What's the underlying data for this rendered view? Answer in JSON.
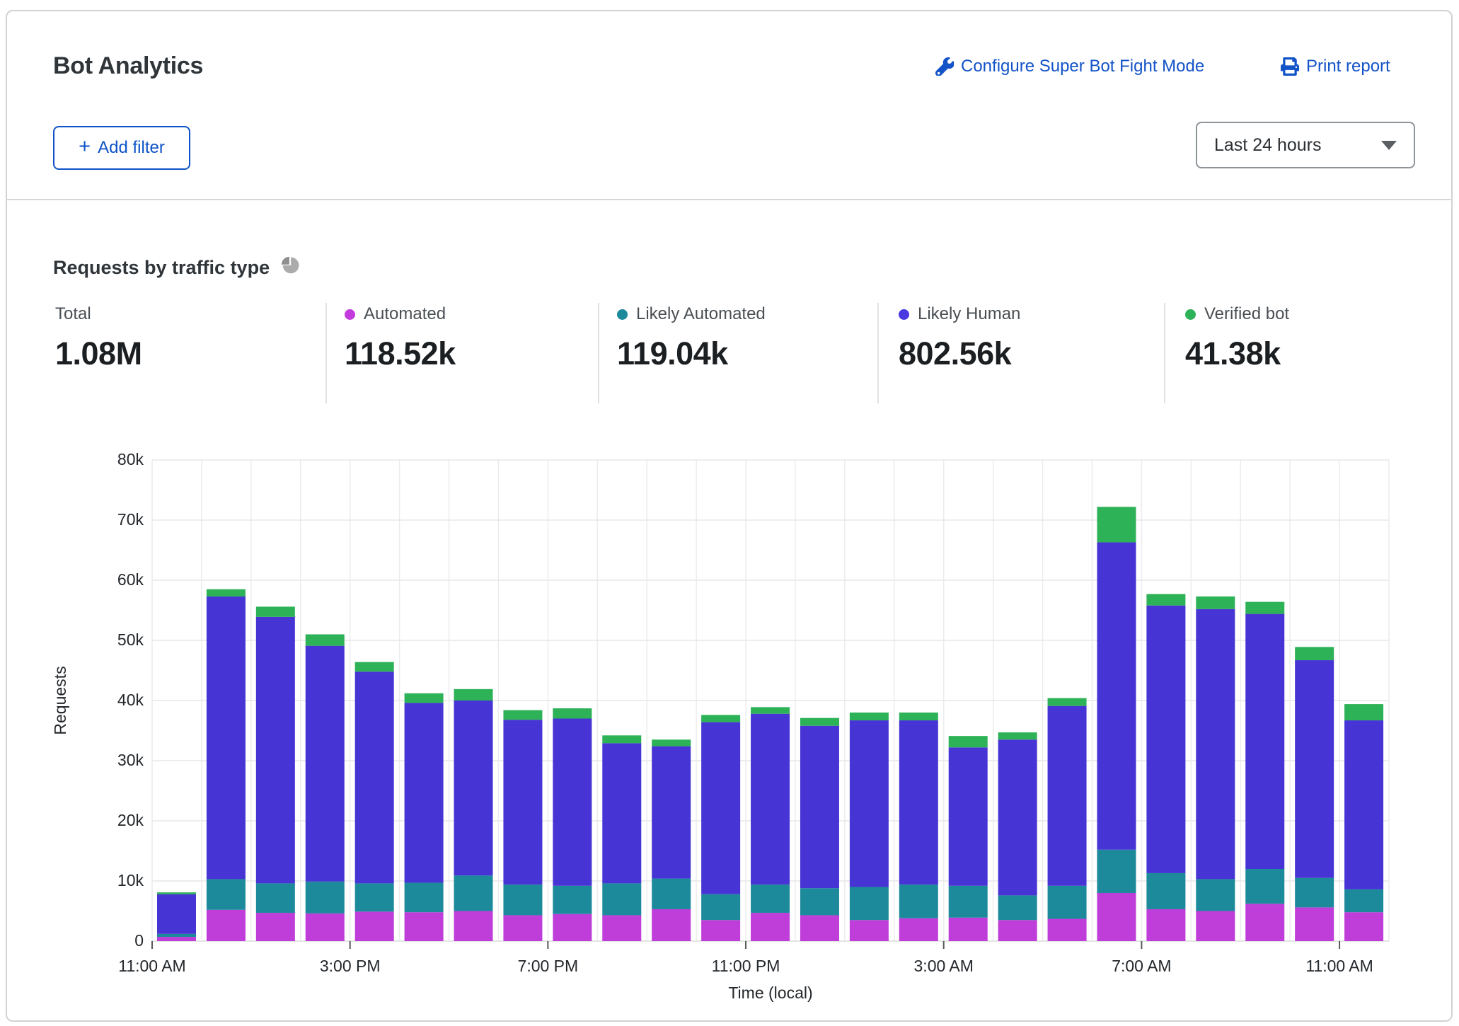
{
  "header": {
    "title": "Bot Analytics",
    "configure_link": "Configure Super Bot Fight Mode",
    "print_link": "Print report",
    "add_filter_plus": "+",
    "add_filter_label": "Add filter",
    "time_range_selected": "Last 24 hours"
  },
  "section": {
    "title": "Requests by traffic type"
  },
  "stats": [
    {
      "label": "Total",
      "value": "1.08M"
    },
    {
      "label": "Automated",
      "value": "118.52k",
      "color": "#c43bdd"
    },
    {
      "label": "Likely Automated",
      "value": "119.04k",
      "color": "#1d8a9c"
    },
    {
      "label": "Likely Human",
      "value": "802.56k",
      "color": "#4b38e0"
    },
    {
      "label": "Verified bot",
      "value": "41.38k",
      "color": "#2db258"
    }
  ],
  "link_color": "#1253c8",
  "chart_data": {
    "type": "bar",
    "stacked": true,
    "title": "Requests by traffic type",
    "xlabel": "Time (local)",
    "ylabel": "Requests",
    "ylim": [
      0,
      80000
    ],
    "grid": true,
    "num_bars": 25,
    "ytick_labels": [
      "0",
      "10k",
      "20k",
      "30k",
      "40k",
      "50k",
      "60k",
      "70k",
      "80k"
    ],
    "xticks": [
      {
        "index": 0,
        "label": "11:00 AM"
      },
      {
        "index": 4,
        "label": "3:00 PM"
      },
      {
        "index": 8,
        "label": "7:00 PM"
      },
      {
        "index": 12,
        "label": "11:00 PM"
      },
      {
        "index": 16,
        "label": "3:00 AM"
      },
      {
        "index": 20,
        "label": "7:00 AM"
      },
      {
        "index": 24,
        "label": "11:00 AM"
      }
    ],
    "series": [
      {
        "name": "Automated",
        "color": "#bf3dd9",
        "values": [
          700,
          5200,
          4700,
          4600,
          4900,
          4800,
          5000,
          4300,
          4500,
          4300,
          5300,
          3500,
          4700,
          4300,
          3500,
          3800,
          3900,
          3500,
          3700,
          8000,
          5300,
          5000,
          6200,
          5600,
          4800
        ]
      },
      {
        "name": "Likely Automated",
        "color": "#1d8a9c",
        "values": [
          500,
          5100,
          4900,
          5300,
          4700,
          4900,
          5900,
          5100,
          4700,
          5300,
          5100,
          4300,
          4700,
          4500,
          5500,
          5600,
          5300,
          4100,
          5500,
          7200,
          6000,
          5300,
          5800,
          4900,
          3800
        ]
      },
      {
        "name": "Likely Human",
        "color": "#4634d4",
        "values": [
          6600,
          47000,
          44300,
          39200,
          35200,
          29900,
          29100,
          27400,
          27800,
          23300,
          22000,
          28600,
          28400,
          27000,
          27700,
          27300,
          23000,
          25900,
          29900,
          51100,
          44500,
          44900,
          42400,
          36200,
          28100
        ]
      },
      {
        "name": "Verified bot",
        "color": "#2db258",
        "values": [
          300,
          1200,
          1700,
          1900,
          1600,
          1600,
          1900,
          1600,
          1700,
          1300,
          1100,
          1200,
          1100,
          1300,
          1300,
          1300,
          1900,
          1200,
          1300,
          5900,
          1900,
          2100,
          2000,
          2200,
          2700
        ]
      }
    ]
  }
}
